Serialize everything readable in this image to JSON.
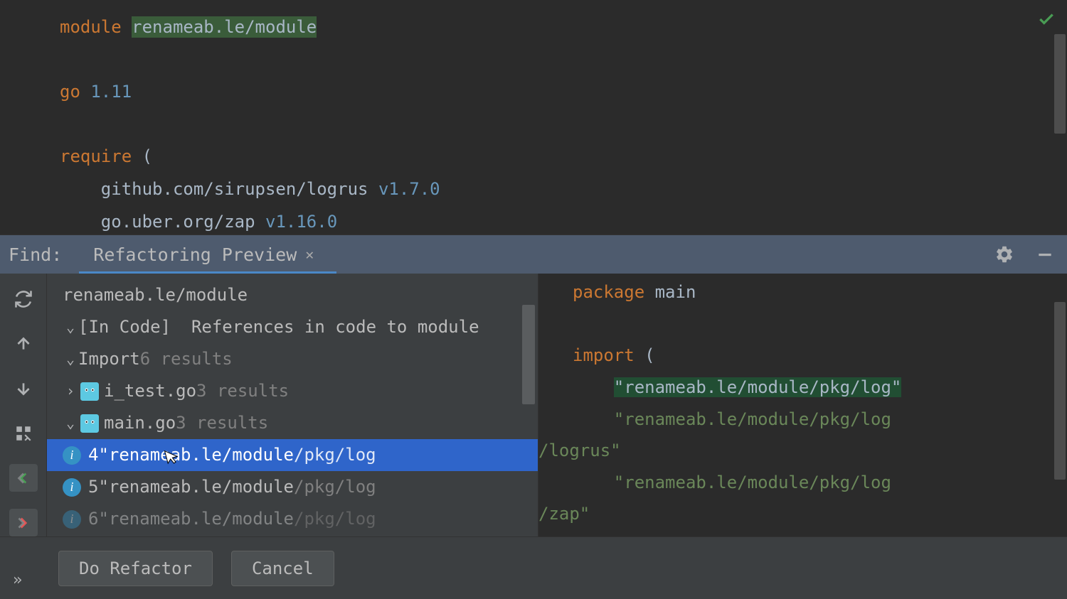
{
  "editor": {
    "line1_kw": "module",
    "line1_path": "renameab.le/module",
    "line2_kw": "go",
    "line2_ver": "1.11",
    "line3_kw": "require",
    "line3_paren": " (",
    "dep1_lib": "github.com/sirupsen/logrus",
    "dep1_ver": "v1.7.0",
    "dep2_lib": "go.uber.org/zap",
    "dep2_ver": "v1.16.0"
  },
  "find": {
    "label": "Find:",
    "tab": "Refactoring Preview"
  },
  "tree": {
    "root_path": "renameab.le/module",
    "section": "[In Code]  References in code to module",
    "import_label": "Import",
    "import_count": "6 results",
    "file1": "i_test.go",
    "file1_count": "3 results",
    "file2": "main.go",
    "file2_count": "3 results",
    "ref1_num": "4",
    "ref1_a": "\"renameab.le/module",
    "ref1_b": "/pkg/log",
    "ref2_num": "5",
    "ref2_a": "\"renameab.le/module",
    "ref2_b": "/pkg/log",
    "ref3_num": "6",
    "ref3_a": "\"renameab.le/module",
    "ref3_b": "/pkg/log"
  },
  "preview": {
    "pkg_kw": "package",
    "pkg_name": "main",
    "import_kw": "import",
    "import_paren": " (",
    "imp1": "\"renameab.le/module/pkg/log\"",
    "imp2a": "\"renameab.le/module/pkg/log",
    "imp2b": "/logrus\"",
    "imp3a": "\"renameab.le/module/pkg/log",
    "imp3b": "/zap\""
  },
  "buttons": {
    "refactor": "Do Refactor",
    "cancel": "Cancel"
  }
}
